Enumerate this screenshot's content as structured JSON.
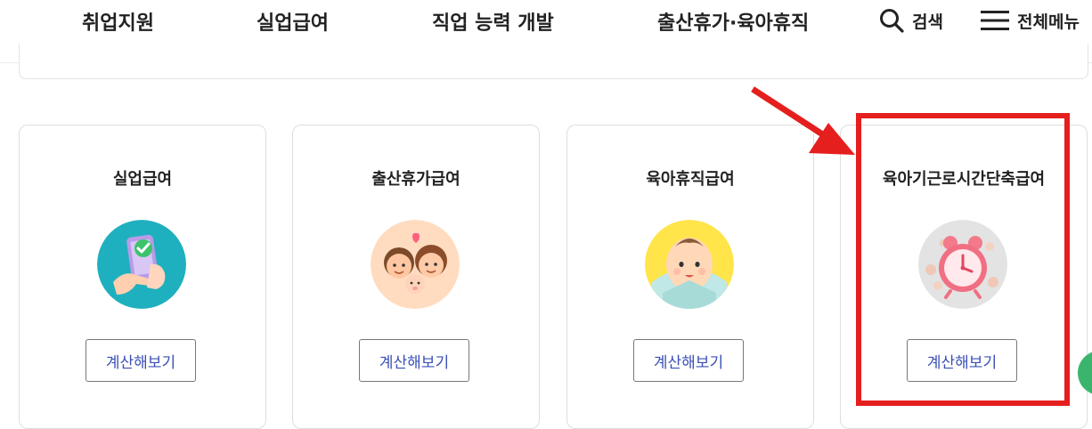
{
  "nav": {
    "items": [
      "취업지원",
      "실업급여",
      "직업 능력 개발",
      "출산휴가·육아휴직"
    ],
    "search_label": "검색",
    "menu_label": "전체메뉴"
  },
  "cards": [
    {
      "title": "실업급여",
      "button": "계산해보기",
      "icon": "phone-checkmark-illustration"
    },
    {
      "title": "출산휴가급여",
      "button": "계산해보기",
      "icon": "family-illustration"
    },
    {
      "title": "육아휴직급여",
      "button": "계산해보기",
      "icon": "baby-illustration"
    },
    {
      "title": "육아기근로시간단축급여",
      "button": "계산해보기",
      "icon": "alarm-clock-illustration"
    }
  ],
  "colors": {
    "highlight": "#e51e1e",
    "button_text": "#3a4fb5",
    "card_border": "#dedede"
  }
}
